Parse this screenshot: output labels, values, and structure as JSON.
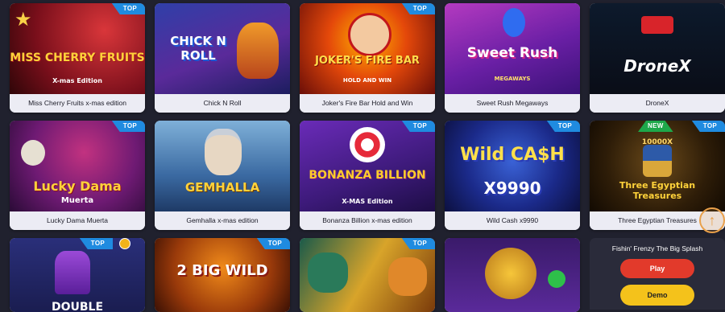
{
  "badges": {
    "top": "TOP",
    "new": "NEW"
  },
  "games": [
    {
      "name": "Miss Cherry Fruits x-mas edition",
      "art": "MISS CHERRY FRUITS",
      "sub": "X-mas Edition"
    },
    {
      "name": "Chick N Roll",
      "art": "CHICK N ROLL",
      "sub": ""
    },
    {
      "name": "Joker's Fire Bar Hold and Win",
      "art": "JOKER'S FIRE BAR",
      "sub": "HOLD AND WIN"
    },
    {
      "name": "Sweet Rush Megaways",
      "art": "Sweet Rush",
      "sub": "MEGAWAYS"
    },
    {
      "name": "DroneX",
      "art": "DroneX",
      "sub": ""
    },
    {
      "name": "Lucky Dama Muerta",
      "art": "Lucky Dama",
      "sub": "Muerta"
    },
    {
      "name": "Gemhalla x-mas edition",
      "art": "GEMHALLA",
      "sub": ""
    },
    {
      "name": "Bonanza Billion x-mas edition",
      "art": "BONANZA BILLION",
      "sub": "X-MAS Edition"
    },
    {
      "name": "Wild Cash x9990",
      "art": "Wild CA$H",
      "sub": "X9990"
    },
    {
      "name": "Three Egyptian Treasures",
      "art": "Three Egyptian Treasures",
      "sub": "10000X"
    },
    {
      "art": "DOUBLE"
    },
    {
      "art": "2 BIG WILD"
    },
    {
      "art": ""
    },
    {
      "art": ""
    }
  ],
  "feature": {
    "title": "Fishin' Frenzy The Big Splash",
    "play": "Play",
    "demo": "Demo"
  },
  "colors": {
    "top_badge": "#1f8be0",
    "new_badge": "#1ea84a",
    "play": "#e23a2b",
    "demo": "#f4c21b"
  }
}
